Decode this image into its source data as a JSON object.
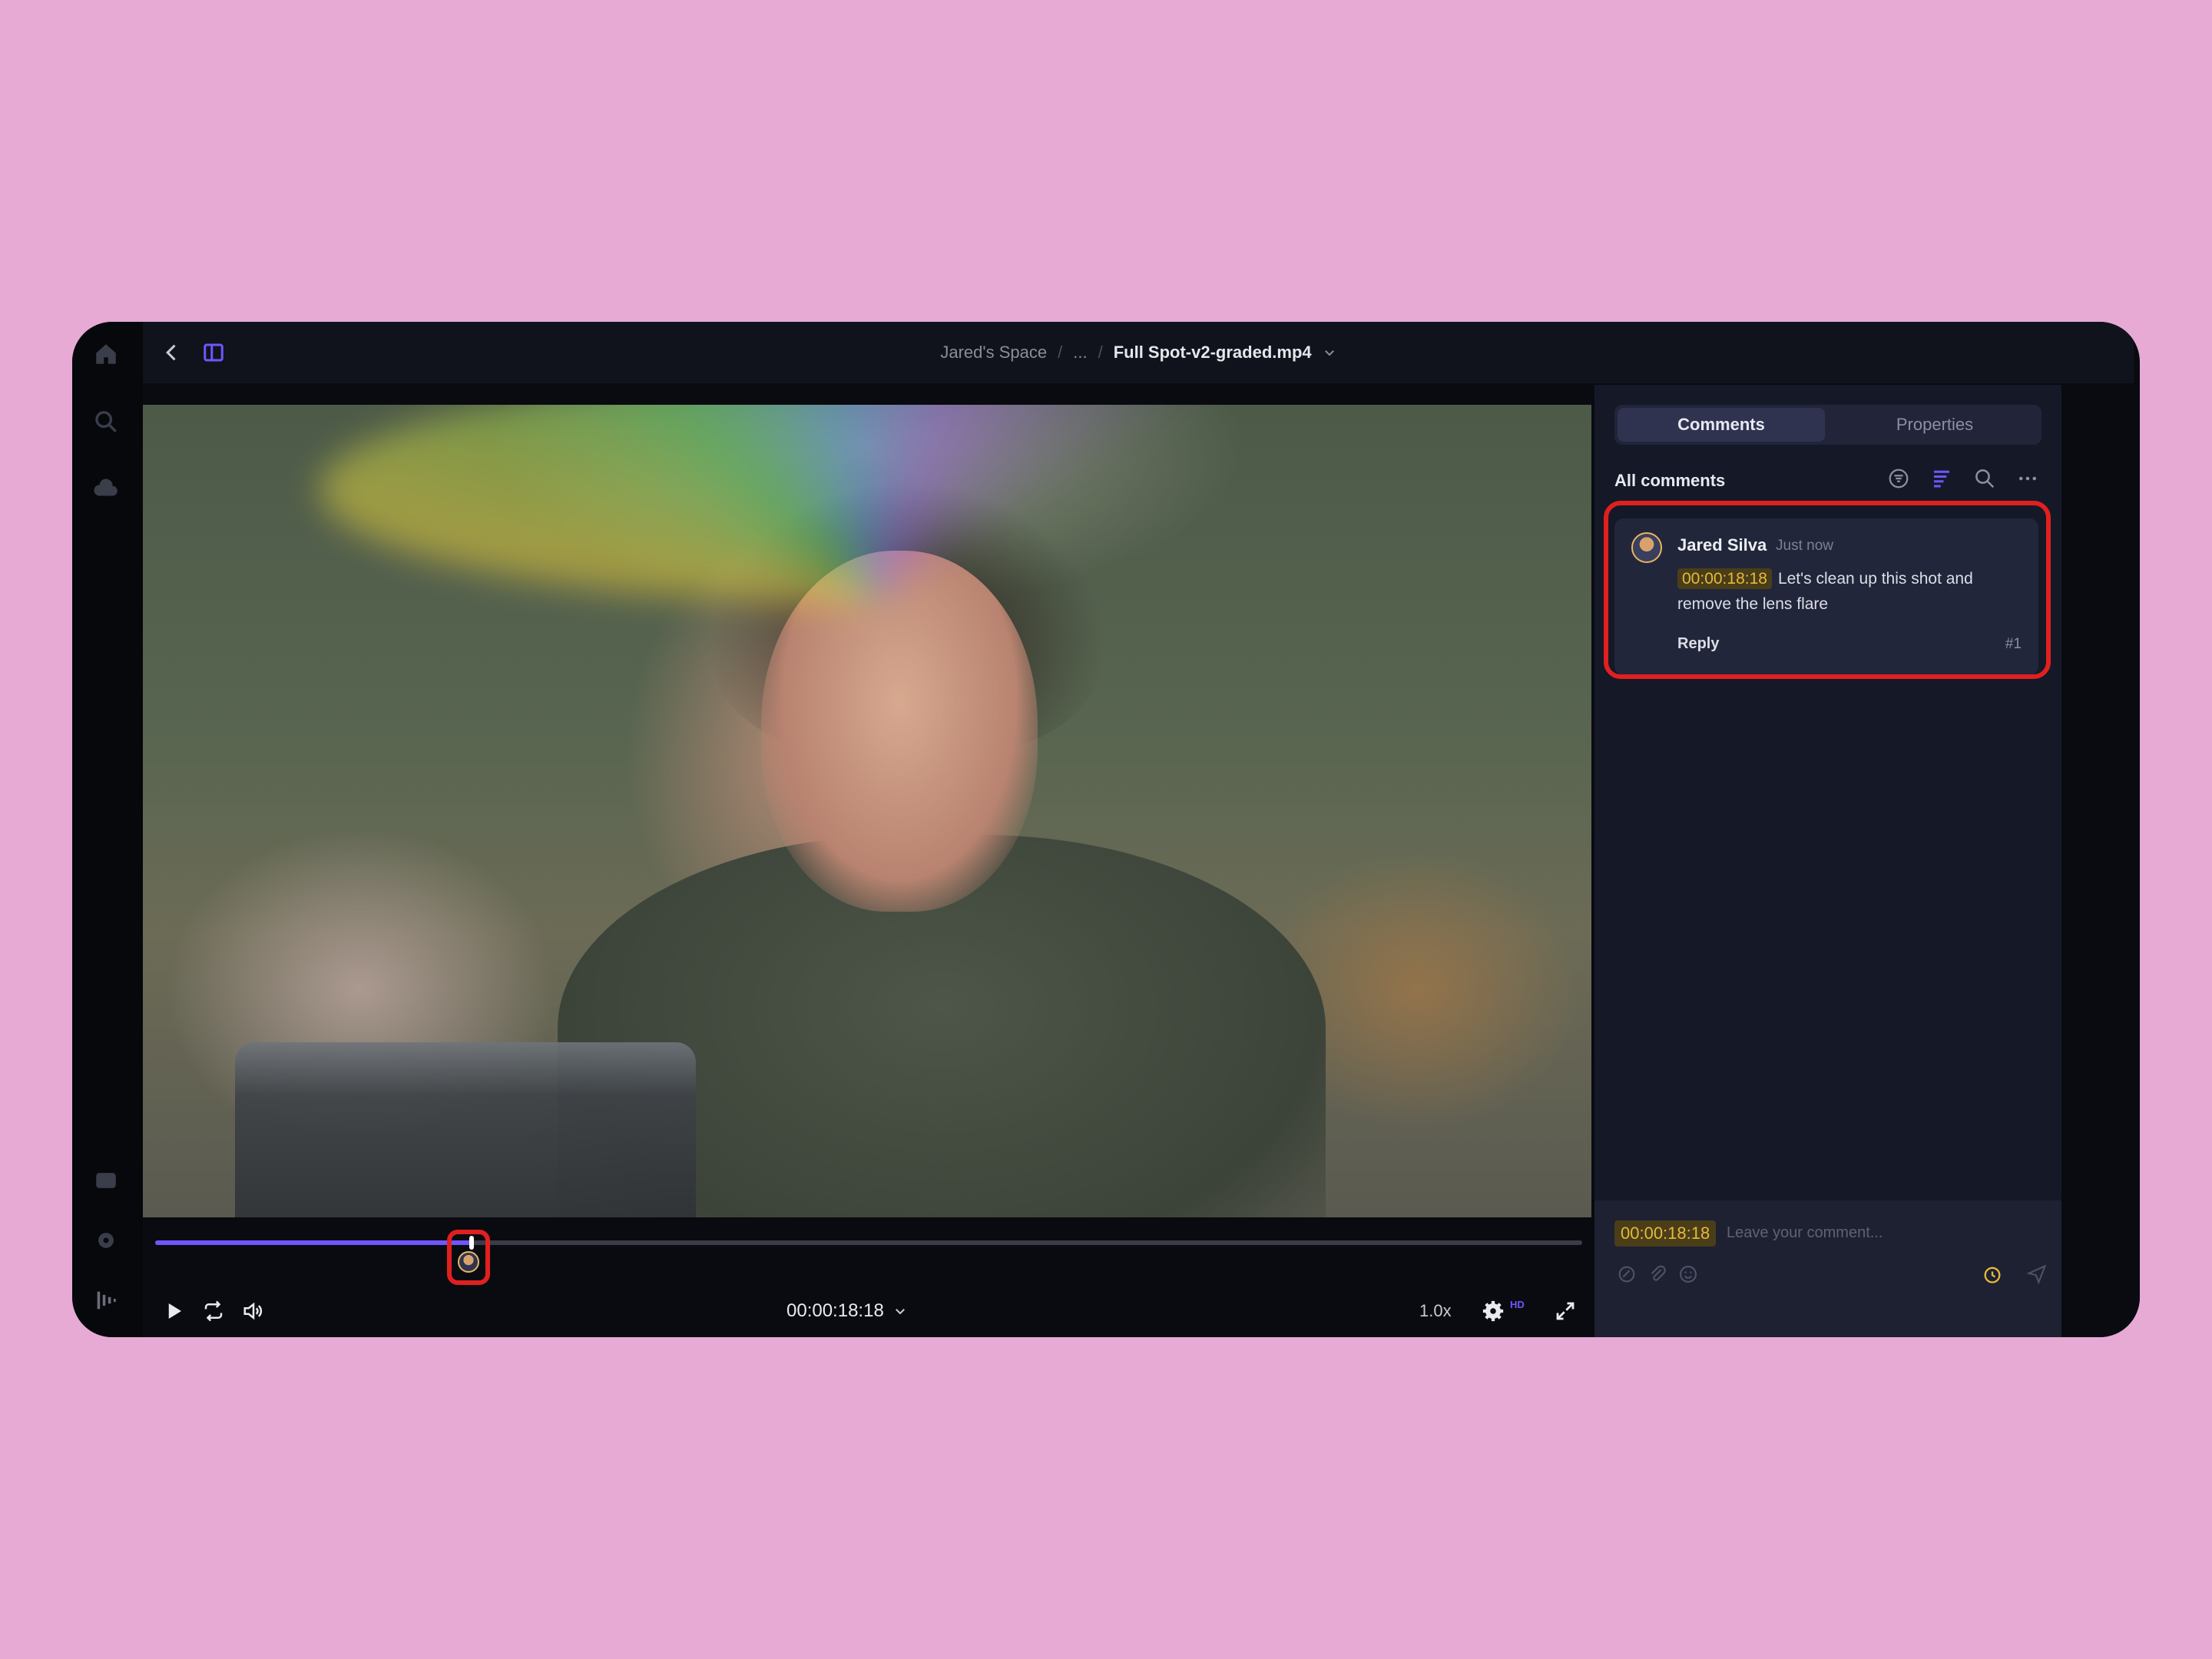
{
  "header": {
    "breadcrumb": {
      "workspace": "Jared's Space",
      "separator": "/",
      "ellipsis": "...",
      "file": "Full Spot-v2-graded.mp4"
    }
  },
  "player": {
    "progress_fraction": 0.222,
    "timecode": "00:00:18:18",
    "speed": "1.0x",
    "quality": "HD"
  },
  "sidebar": {
    "tabs": [
      {
        "label": "Comments",
        "active": true
      },
      {
        "label": "Properties",
        "active": false
      }
    ],
    "list_title": "All comments",
    "comments": [
      {
        "author": "Jared Silva",
        "time_ago": "Just now",
        "timecode": "00:00:18:18",
        "text": "Let's clean up this shot and remove the lens flare",
        "reply_label": "Reply",
        "number": "#1"
      }
    ],
    "composer": {
      "timecode": "00:00:18:18",
      "placeholder": "Leave your comment..."
    }
  },
  "colors": {
    "accent": "#6f56ff",
    "highlight": "#e0201f",
    "timecode_chip": "#e5b93a",
    "background": "#e6aad5"
  }
}
